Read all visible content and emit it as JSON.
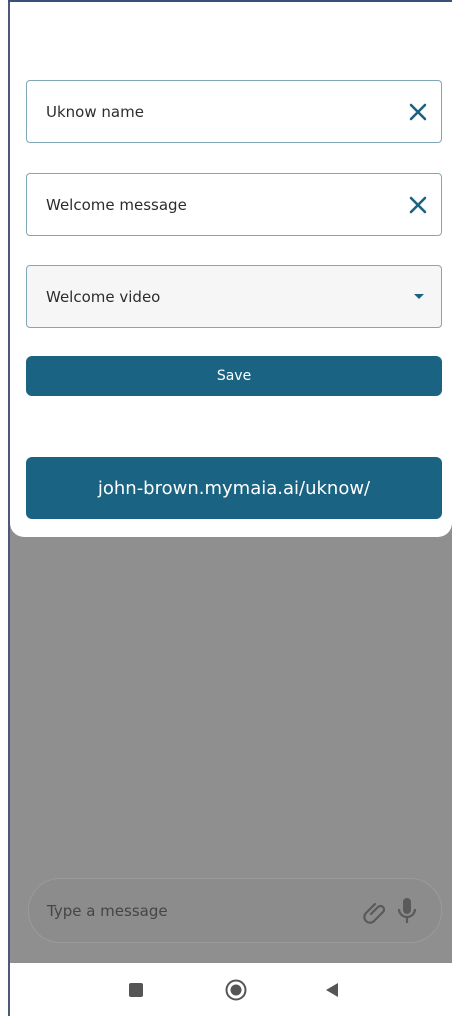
{
  "form": {
    "uknow_name": {
      "value": "Uknow name",
      "clear_icon": "close-icon"
    },
    "welcome_message": {
      "value": "Welcome message",
      "clear_icon": "close-icon"
    },
    "welcome_video": {
      "value": "Welcome video",
      "dropdown_icon": "caret-down-icon"
    },
    "save_label": "Save",
    "link_label": "john-brown.mymaia.ai/uknow/"
  },
  "composer": {
    "placeholder": "Type a message",
    "icons": [
      "paperclip-icon",
      "microphone-icon"
    ]
  },
  "navbar": {
    "icons": [
      "recents-square-icon",
      "home-circle-icon",
      "back-triangle-icon"
    ]
  },
  "colors": {
    "accent": "#1b6382",
    "field_border": "#7fa7b8",
    "overlay": "#8f8f8f",
    "clear_icon": "#1b6382"
  }
}
